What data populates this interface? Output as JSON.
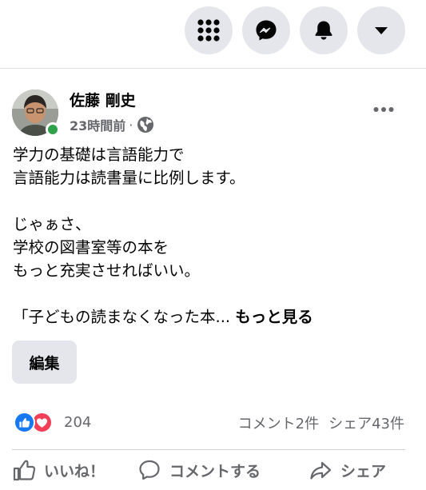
{
  "post": {
    "author_name": "佐藤 剛史",
    "timestamp": "23時間前",
    "separator": "·",
    "body_lines": [
      "学力の基礎は言語能力で",
      "言語能力は読書量に比例します。",
      "",
      "じゃぁさ、",
      "学校の図書室等の本を",
      "もっと充実させればいい。",
      "",
      "「子どもの読まなくなった本... "
    ],
    "see_more_label": "もっと見る",
    "edit_label": "編集",
    "reactions_count": "204",
    "comments_count": "コメント2件",
    "shares_count": "シェア43件"
  },
  "actions": {
    "like_label": "いいね！",
    "comment_label": "コメントする",
    "share_label": "シェア"
  },
  "colors": {
    "accent_blue": "#1877f2",
    "love_red": "#f33e58",
    "online_green": "#31a24c",
    "secondary_text": "#65676b",
    "button_gray": "#e4e6eb"
  },
  "icons": {
    "topbar": [
      "menu-grid-icon",
      "messenger-icon",
      "bell-icon",
      "caret-down-icon"
    ],
    "privacy": "globe-icon",
    "more": "more-dots-icon",
    "reactions": [
      "like-reaction-icon",
      "love-reaction-icon"
    ],
    "actions": [
      "thumbs-up-icon",
      "comment-bubble-icon",
      "share-arrow-icon"
    ]
  }
}
